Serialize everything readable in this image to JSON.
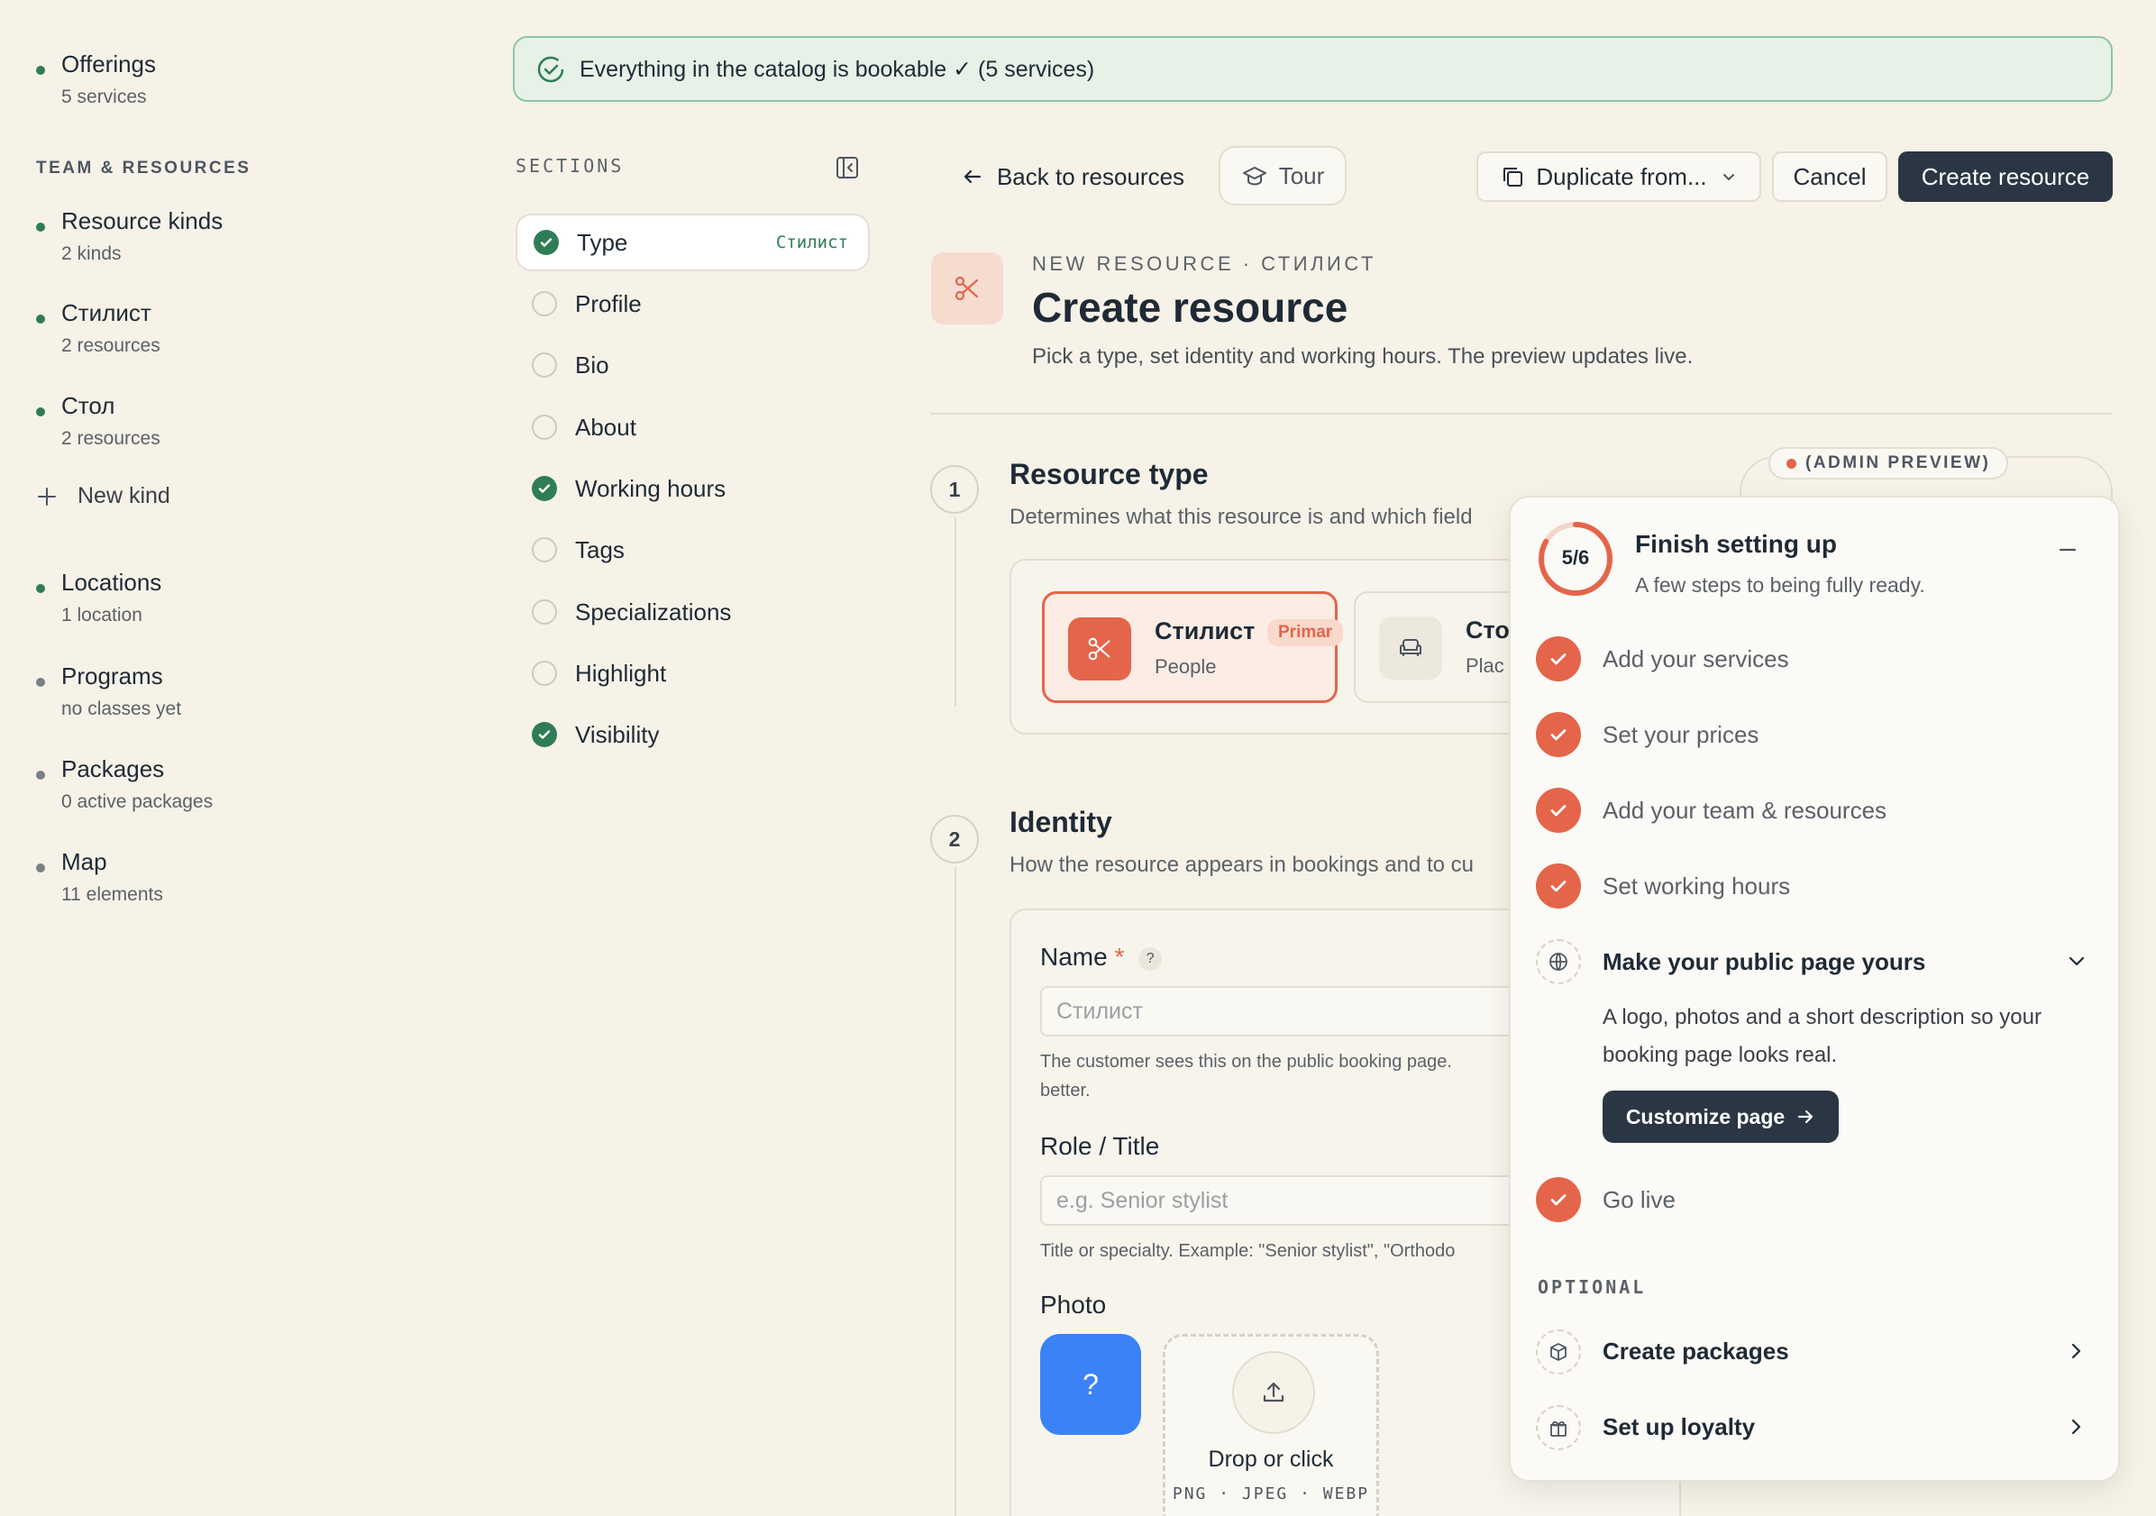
{
  "sidebar": {
    "offerings": {
      "title": "Offerings",
      "sub": "5 services"
    },
    "team_heading": "TEAM & RESOURCES",
    "resource_kinds": {
      "title": "Resource kinds",
      "sub": "2 kinds"
    },
    "stylist": {
      "title": "Стилист",
      "sub": "2 resources"
    },
    "table": {
      "title": "Стол",
      "sub": "2 resources"
    },
    "new_kind": "New kind",
    "locations": {
      "title": "Locations",
      "sub": "1 location"
    },
    "programs": {
      "title": "Programs",
      "sub": "no classes yet"
    },
    "packages": {
      "title": "Packages",
      "sub": "0 active packages"
    },
    "map": {
      "title": "Map",
      "sub": "11 elements"
    }
  },
  "banner": {
    "text": "Everything in the catalog is bookable ✓ (5 services)"
  },
  "sections": {
    "title": "SECTIONS",
    "items": [
      {
        "label": "Type",
        "badge": "Стилист",
        "done": true
      },
      {
        "label": "Profile",
        "done": false
      },
      {
        "label": "Bio",
        "done": false
      },
      {
        "label": "About",
        "done": false
      },
      {
        "label": "Working hours",
        "done": true
      },
      {
        "label": "Tags",
        "done": false
      },
      {
        "label": "Specializations",
        "done": false
      },
      {
        "label": "Highlight",
        "done": false
      },
      {
        "label": "Visibility",
        "done": true
      }
    ]
  },
  "toolbar": {
    "back": "Back to resources",
    "tour": "Tour",
    "duplicate": "Duplicate from...",
    "cancel": "Cancel",
    "create": "Create resource"
  },
  "header": {
    "eyebrow": "NEW RESOURCE · СТИЛИСТ",
    "title": "Create resource",
    "subtitle": "Pick a type, set identity and working hours. The preview updates live."
  },
  "step1": {
    "num": "1",
    "title": "Resource type",
    "sub": "Determines what this resource is and which field",
    "cards": [
      {
        "name": "Стилист",
        "sub": "People",
        "pill": "Primar"
      },
      {
        "name": "Сто",
        "sub": "Plac"
      }
    ]
  },
  "step2": {
    "num": "2",
    "title": "Identity",
    "sub": "How the resource appears in bookings and to cu",
    "name_label": "Name",
    "required_mark": "*",
    "help_mark": "?",
    "name_placeholder": "Стилист",
    "name_help_1": "The customer sees this on the public booking page.",
    "name_help_2": "better.",
    "role_label": "Role / Title",
    "role_placeholder": "e.g. Senior stylist",
    "role_help": "Title or specialty. Example: \"Senior stylist\", \"Orthodo",
    "photo_label": "Photo",
    "photo_avatar": "?",
    "drop_title": "Drop or click",
    "drop_formats": "PNG · JPEG · WEBP"
  },
  "admin_preview": {
    "label": "(ADMIN PREVIEW)"
  },
  "setup": {
    "progress": "5/6",
    "progress_fraction": 0.833,
    "title": "Finish setting up",
    "subtitle": "A few steps to being fully ready.",
    "tasks": [
      {
        "label": "Add your services",
        "done": true
      },
      {
        "label": "Set your prices",
        "done": true
      },
      {
        "label": "Add your team & resources",
        "done": true
      },
      {
        "label": "Set working hours",
        "done": true
      }
    ],
    "public_page": {
      "title": "Make your public page yours",
      "desc_1": "A logo, photos and a short description so your",
      "desc_2": "booking page looks real.",
      "cta": "Customize page"
    },
    "go_live": "Go live",
    "optional_heading": "OPTIONAL",
    "optional": [
      {
        "label": "Create packages"
      },
      {
        "label": "Set up loyalty"
      }
    ]
  },
  "colors": {
    "accent": "#e4654a",
    "success": "#2f7d57",
    "dark": "#2b3644",
    "background": "#f6f2e8"
  }
}
